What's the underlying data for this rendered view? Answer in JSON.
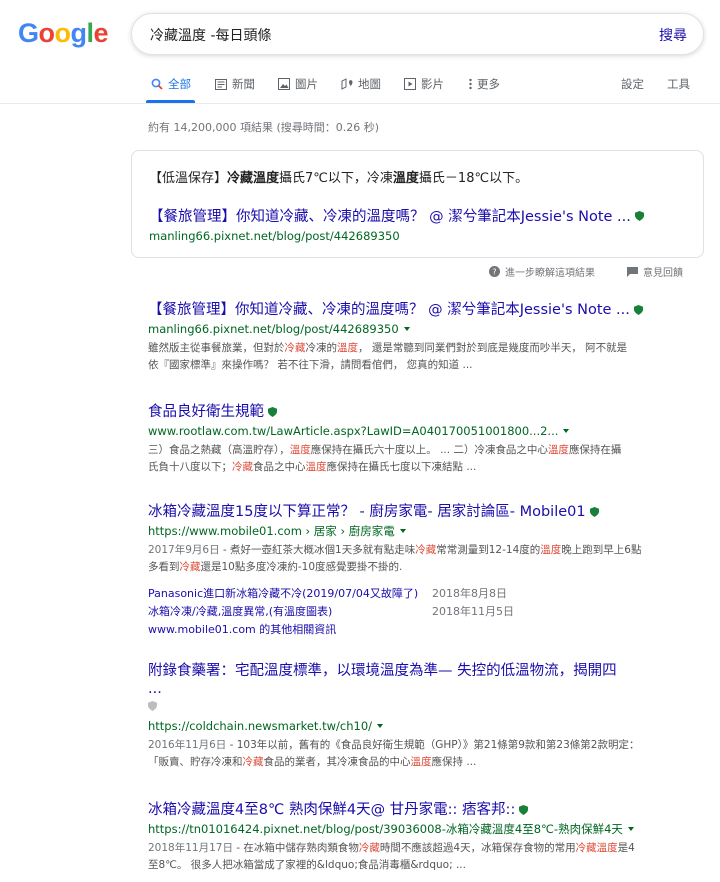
{
  "logo": [
    "G",
    "o",
    "o",
    "g",
    "l",
    "e"
  ],
  "logo_colors": [
    "#4285f4",
    "#ea4335",
    "#fbbc05",
    "#4285f4",
    "#34a853",
    "#ea4335"
  ],
  "search": {
    "query": "冷藏溫度 -每日頭條",
    "button": "搜尋"
  },
  "tabs": [
    {
      "label": "全部",
      "icon": "search-icon",
      "active": true
    },
    {
      "label": "新聞",
      "icon": "news-icon"
    },
    {
      "label": "圖片",
      "icon": "image-icon"
    },
    {
      "label": "地圖",
      "icon": "map-pin-icon"
    },
    {
      "label": "影片",
      "icon": "video-icon"
    },
    {
      "label": "更多",
      "icon": "more-dots-icon"
    }
  ],
  "tools": {
    "settings": "設定",
    "tools": "工具"
  },
  "stats": "約有 14,200,000 項結果 (搜尋時間：0.26 秒)",
  "featured": {
    "answer": [
      "【低溫保存】",
      "冷藏溫度",
      "攝氏7℃以下，冷凍",
      "溫度",
      "攝氏－18℃以下。"
    ],
    "title": "【餐旅管理】你知道冷藏、冷凍的溫度嗎？ @ 潔兮筆記本Jessie's Note ...",
    "url": "manling66.pixnet.net/blog/post/442689350"
  },
  "feedback": {
    "about": "進一步瞭解這項結果",
    "report": "意見回饋"
  },
  "results": [
    {
      "title": "【餐旅管理】你知道冷藏、冷凍的溫度嗎？ @ 潔兮筆記本Jessie's Note ...",
      "url": "manling66.pixnet.net/blog/post/442689350",
      "desc1": [
        "雖然版主從事餐旅業，但對於",
        "冷藏",
        "冷凍的",
        "溫度",
        "， 還是常聽到同業們對於到底是幾度而吵半天， 阿不就是"
      ],
      "desc2": [
        "依『國家標準』來操作嗎？ 若不往下滑，請問看倌們， 您真的知道 ..."
      ]
    },
    {
      "title": "食品良好衛生規範",
      "url": "www.rootlaw.com.tw/LawArticle.aspx?LawID=A040170051001800...2...",
      "desc1": [
        "三）食品之熱藏（高溫貯存），",
        "溫度",
        "應保持在攝氏六十度以上。 ... 二）冷凍食品之中心",
        "溫度",
        "應保持在攝"
      ],
      "desc2": [
        "氏負十八度以下；",
        "冷藏",
        "食品之中心",
        "溫度",
        "應保持在攝氏七度以下凍結點 ..."
      ]
    },
    {
      "title": "冰箱冷藏溫度15度以下算正常？ - 廚房家電- 居家討論區- Mobile01",
      "url": "https://www.mobile01.com › 居家 › 廚房家電",
      "date": "2017年9月6日",
      "desc1": [
        " - 煮好一壺紅茶大概冰個1天多就有點走味",
        "冷藏",
        "常常測量到12-14度的",
        "溫度",
        "晚上跑到早上6點"
      ],
      "desc2": [
        "多看到",
        "冷藏",
        "還是10點多度冷凍約-10度感覺要掛不掛的."
      ],
      "sublinks": [
        {
          "label": "Panasonic進口新冰箱冷藏不冷(2019/07/04又故障了)",
          "date": "2018年8月8日"
        },
        {
          "label": "冰箱冷凍/冷藏,溫度異常,(有溫度圖表)",
          "date": "2018年11月5日"
        }
      ],
      "more": "www.mobile01.com 的其他相關資訊"
    },
    {
      "title": "附錄食藥署：宅配溫度標準，以環境溫度為準— 失控的低溫物流，揭開四",
      "title2": "...",
      "url": "https://coldchain.newsmarket.tw/ch10/",
      "date": "2016年11月6日",
      "desc1": [
        " - 103年以前，舊有的《食品良好衛生規範（GHP）》第21條第9款和第23條第2款明定："
      ],
      "desc2": [
        "「販賣、貯存冷凍和",
        "冷藏",
        "食品的業者，其冷凍食品的中心",
        "溫度",
        "應保持 ..."
      ]
    },
    {
      "title": "冰箱冷藏溫度4至8℃ 熟肉保鮮4天@ 甘丹家電:: 痞客邦::",
      "url": "https://tn01016424.pixnet.net/blog/post/39036008-冰箱冷藏溫度4至8℃-熟肉保鮮4天",
      "date": "2018年11月17日",
      "desc1": [
        " - 在冰箱中儲存熟肉類食物",
        "冷藏",
        "時間不應該超過4天，冰箱保存食物的常用",
        "冷藏溫度",
        "是4"
      ],
      "desc2": [
        "至8℃。 很多人把冰箱當成了家裡的&ldquo;食品消毒櫃&rdquo; ..."
      ]
    }
  ],
  "colors": {
    "link": "#1a0dab",
    "url": "#006621",
    "highlight": "#dd4b39",
    "accent": "#1a73e8"
  }
}
